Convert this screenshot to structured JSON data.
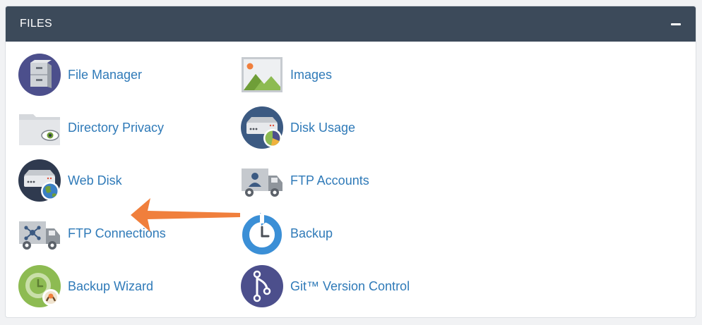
{
  "panel": {
    "title": "FILES",
    "collapse_icon": "minus-icon"
  },
  "colors": {
    "header_bg": "#3c4a5a",
    "link": "#2f7ab8",
    "arrow": "#f07f3c"
  },
  "items": [
    {
      "label": "File Manager",
      "icon": "file-cabinet-icon"
    },
    {
      "label": "Images",
      "icon": "image-landscape-icon"
    },
    {
      "label": "Directory Privacy",
      "icon": "folder-eye-icon"
    },
    {
      "label": "Disk Usage",
      "icon": "disk-pie-chart-icon"
    },
    {
      "label": "Web Disk",
      "icon": "disk-globe-icon"
    },
    {
      "label": "FTP Accounts",
      "icon": "truck-user-icon"
    },
    {
      "label": "FTP Connections",
      "icon": "truck-network-icon"
    },
    {
      "label": "Backup",
      "icon": "backup-clock-icon"
    },
    {
      "label": "Backup Wizard",
      "icon": "backup-wizard-icon"
    },
    {
      "label": "Git™ Version Control",
      "icon": "git-branch-icon"
    }
  ]
}
